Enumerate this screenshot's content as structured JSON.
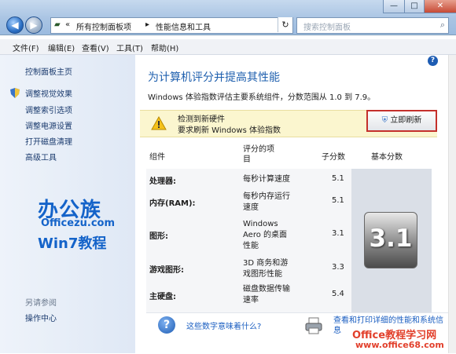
{
  "window": {
    "address_parts": [
      "«",
      "所有控制面板项",
      "▸",
      "性能信息和工具"
    ],
    "search_placeholder": "搜索控制面板",
    "buttons": [
      "—",
      "□",
      "✕"
    ]
  },
  "menu": [
    "文件(F)",
    "编辑(E)",
    "查看(V)",
    "工具(T)",
    "帮助(H)"
  ],
  "sidebar": {
    "items": [
      "控制面板主页",
      "调整视觉效果",
      "调整索引选项",
      "调整电源设置",
      "打开磁盘清理",
      "高级工具"
    ],
    "see_also_heading": "另请参阅",
    "see_also": [
      "操作中心"
    ]
  },
  "watermark": {
    "logo_top": "办公族",
    "logo_url": "Officezu.com",
    "logo_bottom": "Win7教程",
    "corner_top": "Office教程学习网",
    "corner_bottom": "www.office68.com"
  },
  "main": {
    "title": "为计算机评分并提高其性能",
    "description": "Windows 体验指数评估主要系统组件，分数范围从 1.0 到 7.9。",
    "notice": {
      "line1": "检测到新硬件",
      "line2": "要求刷新 Windows 体验指数"
    },
    "refresh_label": "立即刷新",
    "table": {
      "headers": [
        "组件",
        "评分的项\n目",
        "子分数",
        "基本分数"
      ],
      "rows": [
        {
          "component": "处理器:",
          "item": "每秒计算速度",
          "score": "5.1"
        },
        {
          "component": "内存(RAM):",
          "item": "每秒内存运行\n速度",
          "score": "5.1"
        },
        {
          "component": "图形:",
          "item": "Windows\nAero 的桌面\n性能",
          "score": "3.1"
        },
        {
          "component": "游戏图形:",
          "item": "3D 商务和游\n戏图形性能",
          "score": "3.3"
        },
        {
          "component": "主硬盘:",
          "item": "磁盘数据传输\n速率",
          "score": "5.4"
        }
      ],
      "base_score": "3.1"
    },
    "help_link": "这些数字意味着什么?",
    "print_link": "查看和打印详细的性能和系统信息"
  }
}
